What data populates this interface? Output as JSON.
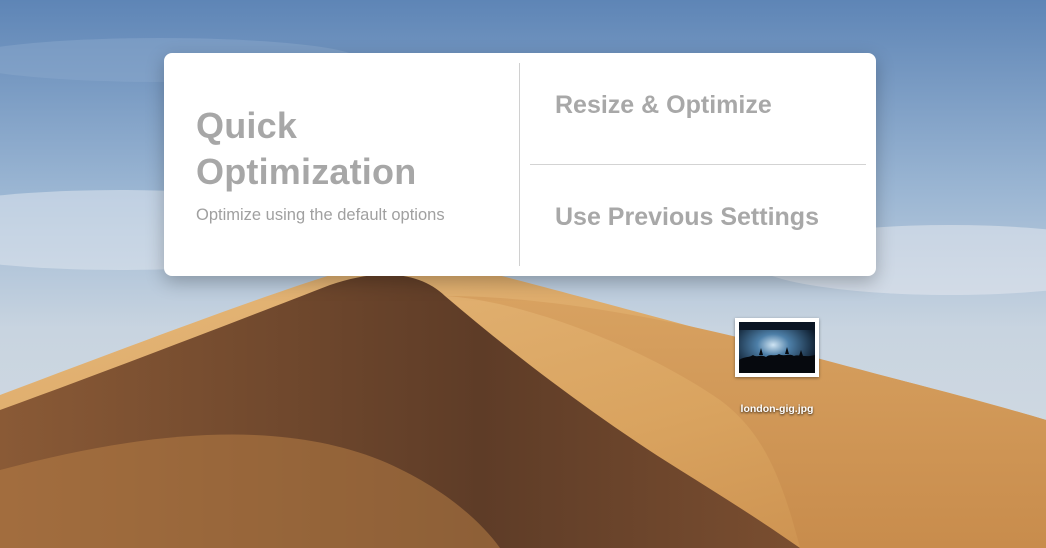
{
  "menu": {
    "quick": {
      "title": "Quick Optimization",
      "subtitle": "Optimize using the default options"
    },
    "resize_label": "Resize & Optimize",
    "previous_label": "Use Previous Settings"
  },
  "desktop": {
    "file_name": "london-gig.jpg"
  },
  "colors": {
    "panel_bg": "#ffffff",
    "label_gray": "#a8a8a8",
    "divider": "#d0d0d0"
  }
}
